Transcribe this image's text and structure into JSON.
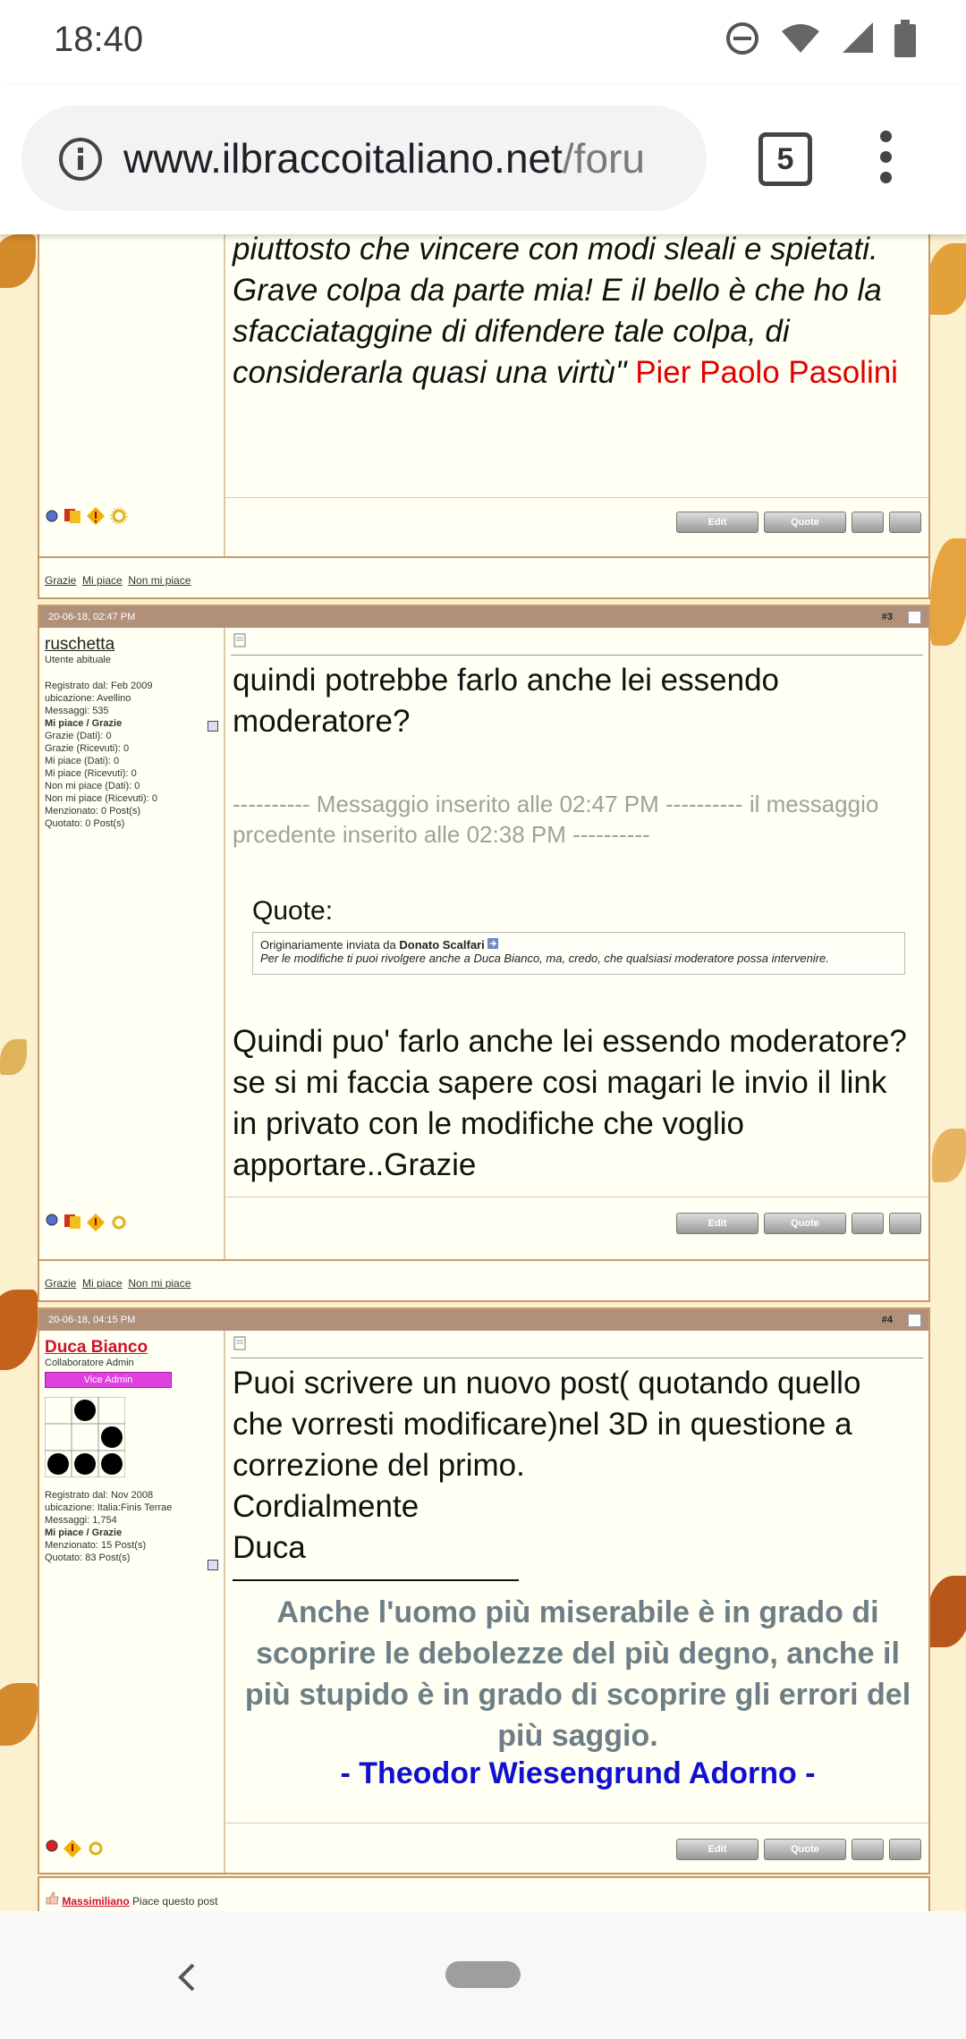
{
  "status": {
    "time": "18:40"
  },
  "browser": {
    "url_main": "www.ilbraccoitaliano.net",
    "url_rest": "/foru",
    "tab_count": "5"
  },
  "post2": {
    "quote_tail": "piuttosto che vincere con modi sleali e spietati. Grave colpa da parte mia! E il bello è che ho la sfacciataggine di difendere tale colpa, di considerarla quasi una virtù\"",
    "author": "Pier Paolo Pasolini"
  },
  "buttons": {
    "edit": "Edit",
    "quote": "Quote"
  },
  "thanks_bar": {
    "grazie": "Grazie",
    "mi_piace": "Mi piace",
    "non_mi_piace": "Non mi piace"
  },
  "post3": {
    "date": "20-06-18, 02:47 PM",
    "num": "#3",
    "user": "ruschetta",
    "role": "Utente abituale",
    "stats": [
      "Registrato dal: Feb 2009",
      "ubicazione: Avellino",
      "Messaggi: 535",
      "Mi piace / Grazie",
      "Grazie (Dati): 0",
      "Grazie (Ricevuti): 0",
      "Mi piace (Dati): 0",
      "Mi piace (Ricevuti): 0",
      "Non mi piace (Dati): 0",
      "Non mi piace (Ricevuti): 0",
      "Menzionato: 0 Post(s)",
      "Quotato: 0 Post(s)"
    ],
    "text1": "quindi potrebbe farlo anche lei essendo moderatore?",
    "merged": "---------- Messaggio inserito alle 02:47 PM ---------- il messaggio prcedente inserito alle 02:38 PM ----------",
    "quote_label": "Quote:",
    "quote_by_prefix": "Originariamente inviata da",
    "quote_by": "Donato Scalfari",
    "quote_text": "Per le modifiche ti puoi rivolgere anche a Duca Bianco, ma, credo, che qualsiasi moderatore possa intervenire.",
    "text2": "Quindi puo' farlo anche lei essendo moderatore? se si mi faccia sapere cosi magari le invio il link in privato con le modifiche che voglio apportare..Grazie"
  },
  "post4": {
    "date": "20-06-18, 04:15 PM",
    "num": "#4",
    "user": "Duca Bianco",
    "role": "Collaboratore Admin",
    "badge": "Vice Admin",
    "stats": [
      "Registrato dal: Nov 2008",
      "ubicazione: Italia:Finis Terrae",
      "Messaggi: 1,754",
      "Mi piace / Grazie",
      "Menzionato: 15 Post(s)",
      "Quotato: 83 Post(s)"
    ],
    "text1": "Puoi scrivere un nuovo post( quotando quello che vorresti modificare)nel 3D in questione a correzione del primo.",
    "text2": "Cordialmente",
    "text3": "Duca",
    "signature": "Anche l'uomo più miserabile è in grado di scoprire le debolezze del più degno, anche il più stupido è in grado di scoprire gli errori del più saggio.",
    "sig_author": "- Theodor Wiesengrund Adorno -"
  },
  "likes": {
    "user": "Massimiliano",
    "text": "Piace questo post"
  },
  "colors": {
    "accent_red": "#e00000",
    "sig_gray": "#6e7e86",
    "sig_blue": "#1010d0",
    "header_brown": "#b1907a"
  }
}
